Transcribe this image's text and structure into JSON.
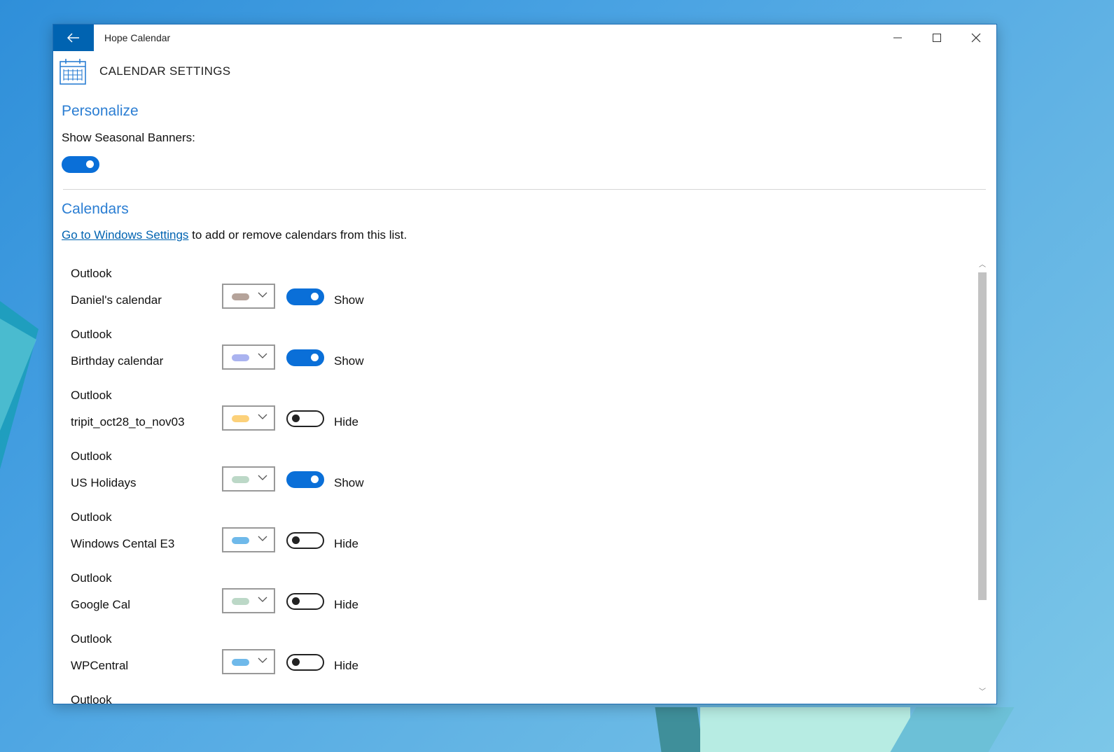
{
  "window": {
    "title": "Hope Calendar"
  },
  "page": {
    "title": "CALENDAR SETTINGS"
  },
  "personalize": {
    "heading": "Personalize",
    "seasonal_label": "Show Seasonal Banners:",
    "seasonal_on": true
  },
  "calendars": {
    "heading": "Calendars",
    "settings_link": "Go to Windows Settings",
    "settings_text": " to add or remove calendars from this list.",
    "items": [
      {
        "provider": "Outlook",
        "name": "Daniel's calendar",
        "color": "#b5a39a",
        "on": true,
        "state": "Show"
      },
      {
        "provider": "Outlook",
        "name": "Birthday calendar",
        "color": "#aab3f0",
        "on": true,
        "state": "Show"
      },
      {
        "provider": "Outlook",
        "name": "tripit_oct28_to_nov03",
        "color": "#fcd17a",
        "on": false,
        "state": "Hide"
      },
      {
        "provider": "Outlook",
        "name": "US Holidays",
        "color": "#bcd8c7",
        "on": true,
        "state": "Show"
      },
      {
        "provider": "Outlook",
        "name": "Windows Cental E3",
        "color": "#6fb9ea",
        "on": false,
        "state": "Hide"
      },
      {
        "provider": "Outlook",
        "name": "Google Cal",
        "color": "#bcd8c7",
        "on": false,
        "state": "Hide"
      },
      {
        "provider": "Outlook",
        "name": "WPCentral",
        "color": "#6fb9ea",
        "on": false,
        "state": "Hide"
      },
      {
        "provider": "Outlook",
        "name": "",
        "color": "#cccccc",
        "on": false,
        "state": ""
      }
    ]
  },
  "icons": {
    "back": "back-arrow-icon",
    "minimize": "minimize-icon",
    "maximize": "maximize-icon",
    "close": "close-icon",
    "calendar": "calendar-icon",
    "chevron": "chevron-down-icon"
  },
  "colors": {
    "accent": "#0a6fd8",
    "heading": "#2b7ed3",
    "titlebar_button": "#0063b1"
  }
}
